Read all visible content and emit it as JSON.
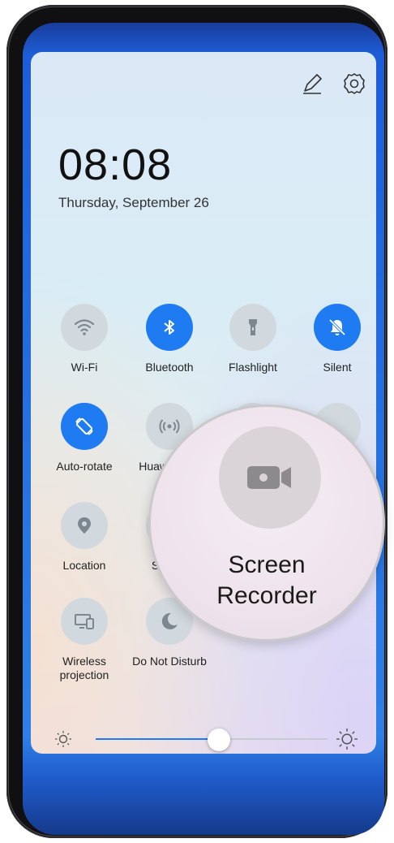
{
  "status": {
    "time": "08:08",
    "date": "Thursday, September 26"
  },
  "header_icons": [
    "edit-icon",
    "gear-icon"
  ],
  "tiles": [
    {
      "label": "Wi-Fi",
      "icon": "wifi-icon",
      "state": "off"
    },
    {
      "label": "Bluetooth",
      "icon": "bluetooth-icon",
      "state": "on"
    },
    {
      "label": "Flashlight",
      "icon": "flashlight-icon",
      "state": "off"
    },
    {
      "label": "Silent",
      "icon": "bell-off-icon",
      "state": "on"
    },
    {
      "label": "Auto-rotate",
      "icon": "auto-rotate-icon",
      "state": "on"
    },
    {
      "label": "Huawei Sha",
      "icon": "huawei-share-icon",
      "state": "off"
    },
    {
      "label": "Location",
      "icon": "location-pin-icon",
      "state": "off"
    },
    {
      "label": "Screen",
      "icon": "screenshot-icon",
      "state": "off"
    },
    {
      "label": "Wireless projection",
      "icon": "wireless-projection-icon",
      "state": "off"
    },
    {
      "label": "Do Not Disturb",
      "icon": "moon-icon",
      "state": "off"
    }
  ],
  "brightness": {
    "level": 0.53,
    "low_icon": "sun-low-icon",
    "high_icon": "sun-high-icon"
  },
  "zoom": {
    "label_line1": "Screen",
    "label_line2": "Recorder",
    "icon": "video-camera-icon"
  },
  "colors": {
    "accent": "#1f7bf1",
    "tile_off": "#d2d9de",
    "icon_off": "#7d8790"
  }
}
